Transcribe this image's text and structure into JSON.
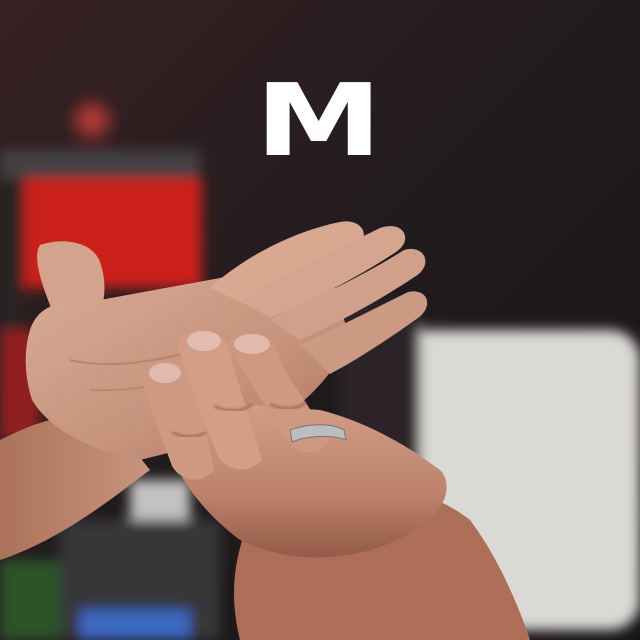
{
  "caption": {
    "letter": "M"
  },
  "colors": {
    "caption_text": "#ffffff",
    "skin": "#d9a58c",
    "background_dark": "#1e1a1c",
    "equipment_red": "#d8221c"
  }
}
